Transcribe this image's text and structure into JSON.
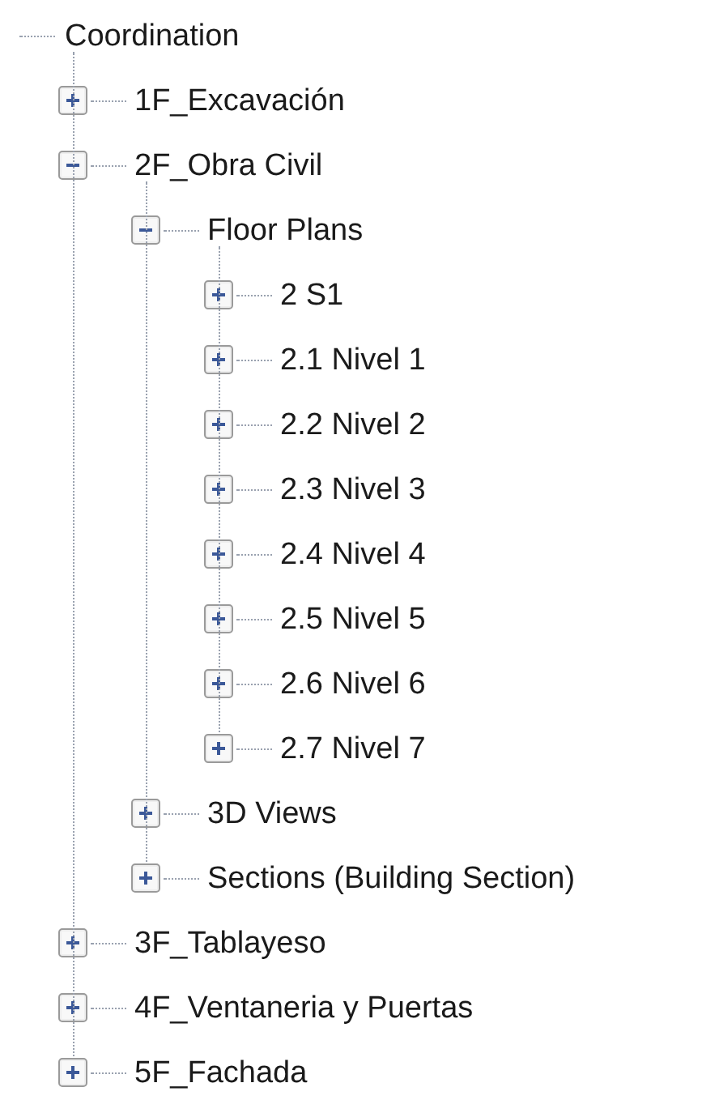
{
  "tree": {
    "label": "Coordination",
    "children": [
      {
        "label": "1F_Excavación",
        "expanded": false
      },
      {
        "label": "2F_Obra Civil",
        "expanded": true,
        "children": [
          {
            "label": "Floor Plans",
            "expanded": true,
            "children": [
              {
                "label": "2 S1",
                "expanded": false
              },
              {
                "label": "2.1 Nivel 1",
                "expanded": false
              },
              {
                "label": "2.2 Nivel 2",
                "expanded": false
              },
              {
                "label": "2.3 Nivel 3",
                "expanded": false
              },
              {
                "label": "2.4 Nivel 4",
                "expanded": false
              },
              {
                "label": "2.5 Nivel 5",
                "expanded": false
              },
              {
                "label": "2.6 Nivel 6",
                "expanded": false
              },
              {
                "label": "2.7 Nivel 7",
                "expanded": false
              }
            ]
          },
          {
            "label": "3D Views",
            "expanded": false
          },
          {
            "label": "Sections (Building Section)",
            "expanded": false
          }
        ]
      },
      {
        "label": "3F_Tablayeso",
        "expanded": false
      },
      {
        "label": "4F_Ventaneria y Puertas",
        "expanded": false
      },
      {
        "label": "5F_Fachada",
        "expanded": false
      }
    ]
  }
}
